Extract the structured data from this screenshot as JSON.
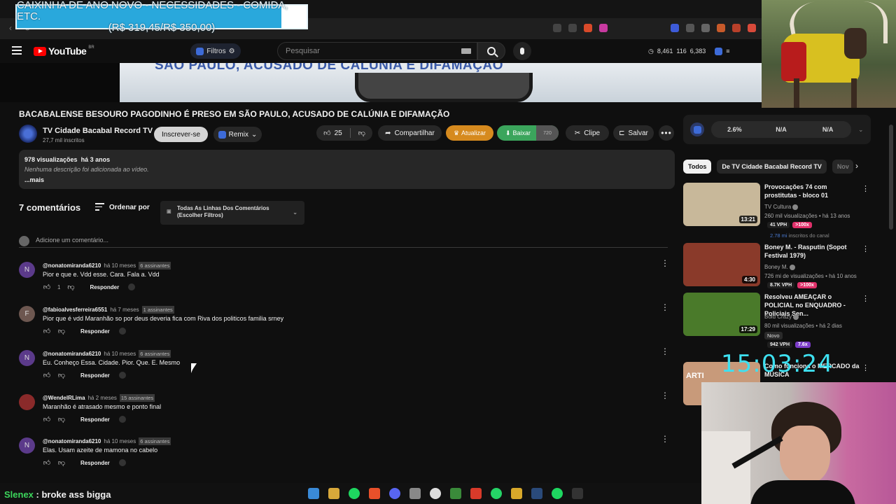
{
  "donation": {
    "title": "CAIXINHA DE ANO NOVO - NECESSIDADES - COMIDA, ETC.",
    "amount": "(R$ 319,45/R$ 350,00)"
  },
  "header": {
    "logo_text": "YouTube",
    "country": "BR",
    "filters_label": "Filtros",
    "search_placeholder": "Pesquisar",
    "stats": [
      "8,461",
      "116",
      "6,383"
    ]
  },
  "video": {
    "thumbnail_text": "SÃO PAULO, ACUSADO DE CALÚNIA E DIFAMAÇÃO",
    "title": "BACABALENSE BESOURO PAGODINHO É PRESO EM SÃO PAULO, ACUSADO DE CALÚNIA E DIFAMAÇÃO",
    "channel_name": "TV Cidade Bacabal Record TV",
    "channel_subs": "27,7 mil inscritos",
    "subscribe_label": "Inscrever-se",
    "remix_label": "Remix",
    "like_count": "25",
    "share_label": "Compartilhar",
    "update_label": "Atualizar",
    "download_label": "Baixar",
    "download_quality": "720",
    "clip_label": "Clipe",
    "save_label": "Salvar",
    "views": "978 visualizações",
    "age": "há 3 anos",
    "description": "Nenhuma descrição foi adicionada ao vídeo.",
    "more_label": "...mais"
  },
  "comments_section": {
    "count_label": "7 comentários",
    "sort_label": "Ordenar por",
    "filter_line1": "Todas As Linhas Dos Comentários",
    "filter_line2": "(Escolher Filtros)",
    "add_placeholder": "Adicione um comentário...",
    "reply_label": "Responder",
    "comments": [
      {
        "initial": "N",
        "avatar_color": "#5b3a8a",
        "author": "@nonatomiranda6210",
        "time": "há 10 meses",
        "badge": "6 assinantes",
        "text": "Pior e que e. Vdd  esse. Cara. Fala a. Vdd",
        "likes": "1"
      },
      {
        "initial": "F",
        "avatar_color": "#6d5750",
        "author": "@fabioalvesferreira6551",
        "time": "há 7 meses",
        "badge": "1 assinantes",
        "text": "Pior que é vdd Maranhão so por deus deveria fica com Riva dos politicos familia srney",
        "likes": ""
      },
      {
        "initial": "N",
        "avatar_color": "#5b3a8a",
        "author": "@nonatomiranda6210",
        "time": "há 10 meses",
        "badge": "6 assinantes",
        "text": "Eu. Conheço  Essa. Cidade. Pior. Que. E. Mesmo",
        "likes": ""
      },
      {
        "initial": "",
        "avatar_color": "#8a2a2a",
        "author": "@WendelRLima",
        "time": "há 2 meses",
        "badge": "15 assinantes",
        "text": "Maranhão é atrasado mesmo e ponto final",
        "likes": ""
      },
      {
        "initial": "N",
        "avatar_color": "#5b3a8a",
        "author": "@nonatomiranda6210",
        "time": "há 10 meses",
        "badge": "6 assinantes",
        "text": "Elas. Usam azeite de mamona no cabelo",
        "likes": ""
      }
    ]
  },
  "sidebar": {
    "stats": [
      "2.6%",
      "N/A",
      "N/A"
    ],
    "chips": [
      "Todos",
      "De TV Cidade Bacabal Record TV",
      "Nov"
    ],
    "recommendations": [
      {
        "title": "Provocações 74 com prostitutas - bloco 01",
        "channel": "TV Cultura",
        "meta": "260 mil visualizações • há 13 anos",
        "duration": "13:21",
        "vph": "41 VPH",
        "mult": ">100x",
        "subs_value": "2.78 mi",
        "subs_label": "inscritos do canal",
        "thumb_bg": "#c8b89a"
      },
      {
        "title": "Boney M. - Rasputin (Sopot Festival 1979)",
        "channel": "Boney M.",
        "meta": "726 mi de visualizações • há 10 anos",
        "duration": "4:30",
        "vph": "8.7K VPH",
        "mult": ">100x",
        "thumb_bg": "#8a3a2a"
      },
      {
        "title": "Resolveu AMEAÇAR o POLICIAL no ENQUADRO - Policiais Sen...",
        "channel": "Bold Crazy",
        "meta": "80 mil visualizações • há 2 dias",
        "duration": "17:29",
        "new": "Novo",
        "vph": "942 VPH",
        "mult": "7.6x",
        "thumb_bg": "#4a7a2a"
      },
      {
        "title": "Como funciona o MERCADO da MÚSICA",
        "thumb_bg": "#c89a7a",
        "thumb_text": "ARTI"
      }
    ]
  },
  "overlay": {
    "clock": "15:03:24",
    "chat_user": "Slenex",
    "chat_message": "broke ass bigga"
  }
}
